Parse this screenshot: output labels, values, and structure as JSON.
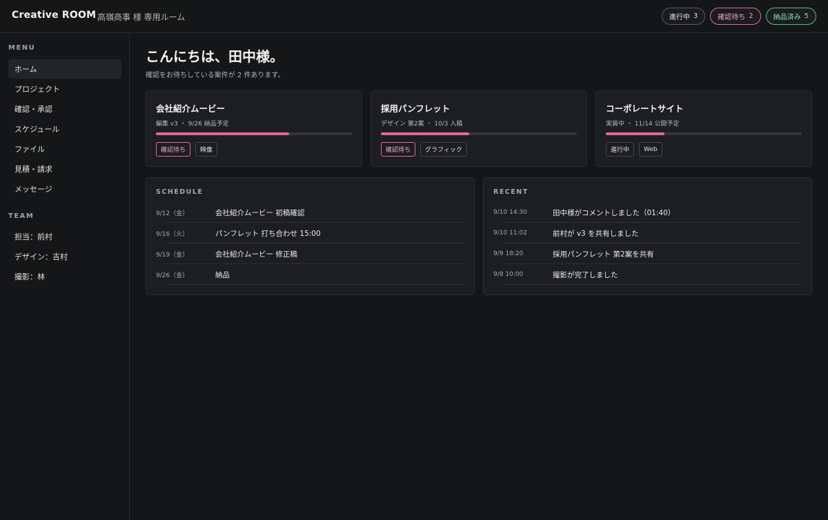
{
  "header": {
    "brand": "Creative ROOM",
    "room": "高嶺商事 様 専用ルーム",
    "pills": [
      {
        "label": "進行中",
        "count": "3",
        "tone": "neutral"
      },
      {
        "label": "確認待ち",
        "count": "2",
        "tone": "pink"
      },
      {
        "label": "納品済み",
        "count": "5",
        "tone": "green"
      }
    ]
  },
  "sidebar": {
    "menu_heading": "MENU",
    "menu": [
      {
        "label": "ホーム",
        "active": true
      },
      {
        "label": "プロジェクト"
      },
      {
        "label": "確認・承認"
      },
      {
        "label": "スケジュール"
      },
      {
        "label": "ファイル"
      },
      {
        "label": "見積・請求"
      },
      {
        "label": "メッセージ"
      }
    ],
    "team_heading": "TEAM",
    "team": [
      {
        "label": "担当：前村"
      },
      {
        "label": "デザイン：吉村"
      },
      {
        "label": "撮影：林"
      }
    ]
  },
  "main": {
    "greeting": "こんにちは、田中様。",
    "subtitle": "確認をお待ちしている案件が 2 件あります。",
    "projects": [
      {
        "title": "会社紹介ムービー",
        "meta": "編集 v3 ・ 9/26 納品予定",
        "progress": 0.68,
        "tags": [
          {
            "label": "確認待ち",
            "tone": "pink"
          },
          {
            "label": "映像",
            "tone": "neutral"
          }
        ]
      },
      {
        "title": "採用パンフレット",
        "meta": "デザイン 第2案 ・ 10/3 入稿",
        "progress": 0.45,
        "tags": [
          {
            "label": "確認待ち",
            "tone": "pink"
          },
          {
            "label": "グラフィック",
            "tone": "neutral"
          }
        ]
      },
      {
        "title": "コーポレートサイト",
        "meta": "実装中 ・ 11/14 公開予定",
        "progress": 0.3,
        "tags": [
          {
            "label": "進行中",
            "tone": "neutral"
          },
          {
            "label": "Web",
            "tone": "neutral"
          }
        ]
      }
    ],
    "schedule": {
      "heading": "SCHEDULE",
      "items": [
        {
          "when": "9/12（金）",
          "what": "会社紹介ムービー 初稿確認"
        },
        {
          "when": "9/16（火）",
          "what": "パンフレット 打ち合わせ 15:00"
        },
        {
          "when": "9/19（金）",
          "what": "会社紹介ムービー 修正稿"
        },
        {
          "when": "9/26（金）",
          "what": "納品"
        }
      ]
    },
    "recent": {
      "heading": "RECENT",
      "items": [
        {
          "when": "9/10 14:30",
          "what": "田中様がコメントしました（01:40）"
        },
        {
          "when": "9/10 11:02",
          "what": "前村が v3 を共有しました"
        },
        {
          "when": "9/9 18:20",
          "what": "採用パンフレット 第2案を共有"
        },
        {
          "when": "9/8 10:00",
          "what": "撮影が完了しました"
        }
      ]
    }
  },
  "colors": {
    "accent": "#e8669a",
    "success": "#56c486",
    "background": "#151618"
  }
}
